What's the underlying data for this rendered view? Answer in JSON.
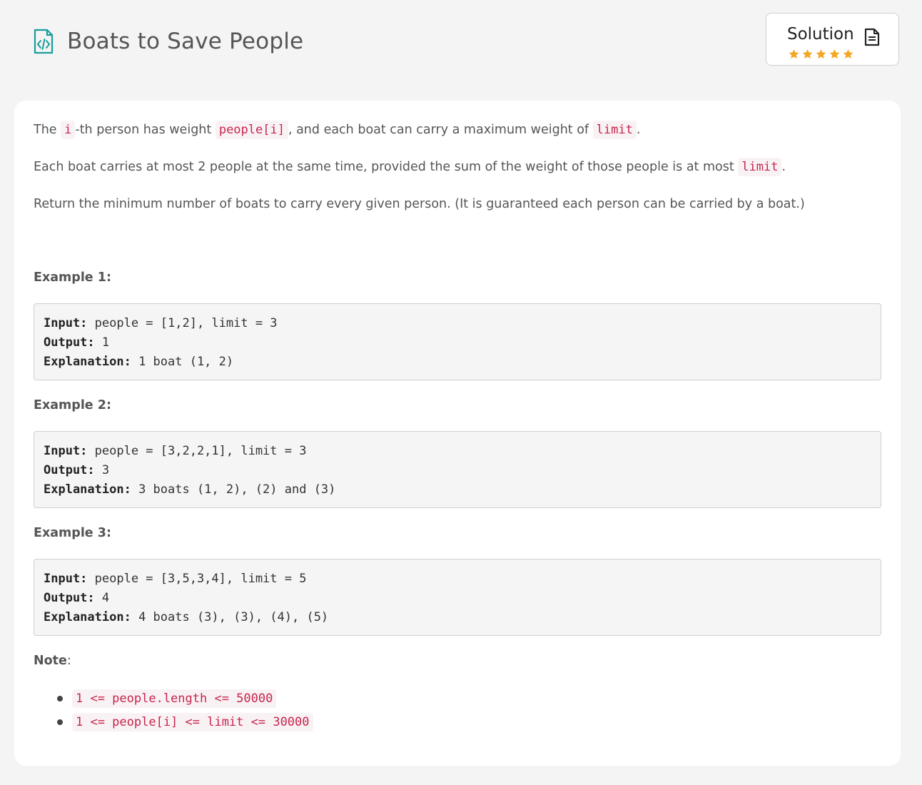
{
  "header": {
    "title": "Boats to Save People"
  },
  "solution_button": {
    "label": "Solution",
    "rating": 5,
    "star_color": "#f5a623"
  },
  "description": {
    "p1": {
      "t1": "The ",
      "c1": "i",
      "t2": "-th person has weight ",
      "c2": "people[i]",
      "t3": ", and each boat can carry a maximum weight of ",
      "c3": "limit",
      "t4": "."
    },
    "p2": {
      "t1": "Each boat carries at most 2 people at the same time, provided the sum of the weight of those people is at most ",
      "c1": "limit",
      "t2": "."
    },
    "p3": "Return the minimum number of boats to carry every given person.  (It is guaranteed each person can be carried by a boat.)"
  },
  "examples": [
    {
      "heading": "Example 1:",
      "input_label": "Input:",
      "input": " people = [1,2], limit = 3",
      "output_label": "Output:",
      "output": " 1",
      "explanation_label": "Explanation:",
      "explanation": " 1 boat (1, 2)"
    },
    {
      "heading": "Example 2:",
      "input_label": "Input:",
      "input": " people = [3,2,2,1], limit = 3",
      "output_label": "Output:",
      "output": " 3",
      "explanation_label": "Explanation:",
      "explanation": " 3 boats (1, 2), (2) and (3)"
    },
    {
      "heading": "Example 3:",
      "input_label": "Input:",
      "input": " people = [3,5,3,4], limit = 5",
      "output_label": "Output:",
      "output": " 4",
      "explanation_label": "Explanation:",
      "explanation": " 4 boats (3), (3), (4), (5)"
    }
  ],
  "note": {
    "heading": "Note",
    "colon": ":",
    "items": [
      "1 <= people.length <= 50000",
      "1 <= people[i] <= limit <= 30000"
    ]
  },
  "colors": {
    "accent_icon": "#1a9c9c",
    "code_text": "#c7254e",
    "code_bg": "#f9f2f4"
  }
}
